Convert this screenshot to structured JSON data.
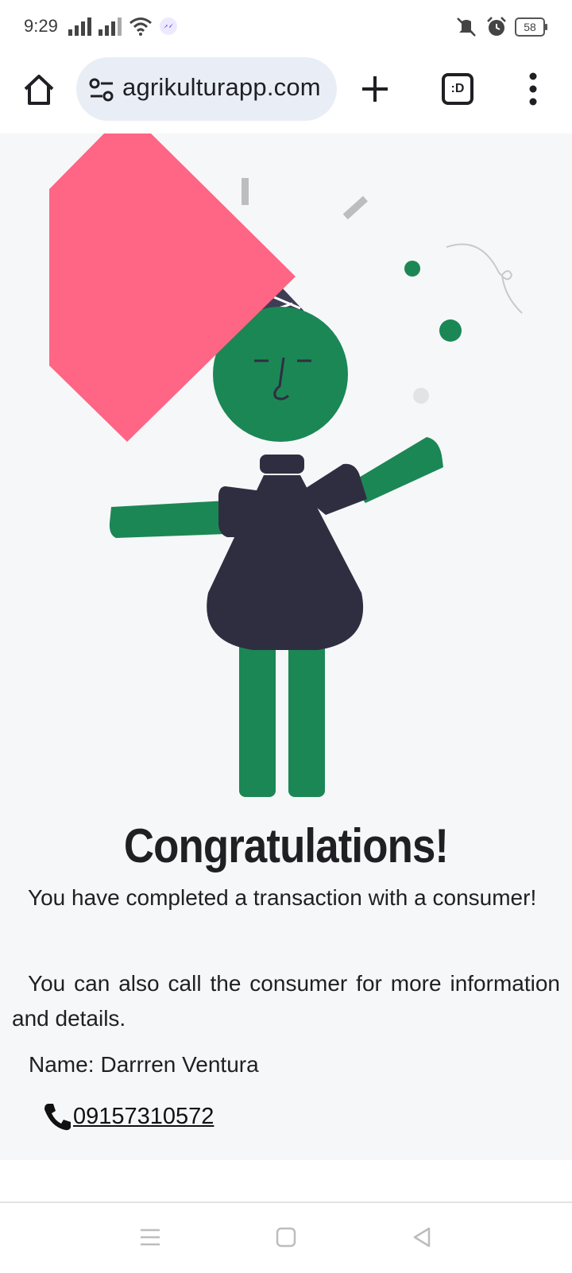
{
  "status_bar": {
    "time": "9:29",
    "battery": "58",
    "icons": [
      "signal-icon",
      "signal-icon",
      "wifi-icon",
      "messenger-icon",
      "mute-vibrate-icon",
      "alarm-icon",
      "battery-icon"
    ]
  },
  "browser": {
    "url": "agrikulturapp.com",
    "tabs_label": ":D",
    "icons": [
      "home-icon",
      "site-settings-icon",
      "new-tab-plus-icon",
      "tabs-icon",
      "more-menu-icon"
    ]
  },
  "colors": {
    "accent_green": "#1b8755",
    "dark_navy": "#2f2e41",
    "pink": "#ff6584",
    "background": "#f6f7f9"
  },
  "main": {
    "title": "Congratulations!",
    "paragraph1": "You have completed a transaction with a consumer!",
    "paragraph2": "You can also call the consumer for more information and details.",
    "name_label": "Name:",
    "name_value": "Darrren Ventura",
    "phone": "09157310572"
  },
  "nav": {
    "icons": [
      "recent-apps-icon",
      "home-square-icon",
      "back-triangle-icon"
    ]
  }
}
